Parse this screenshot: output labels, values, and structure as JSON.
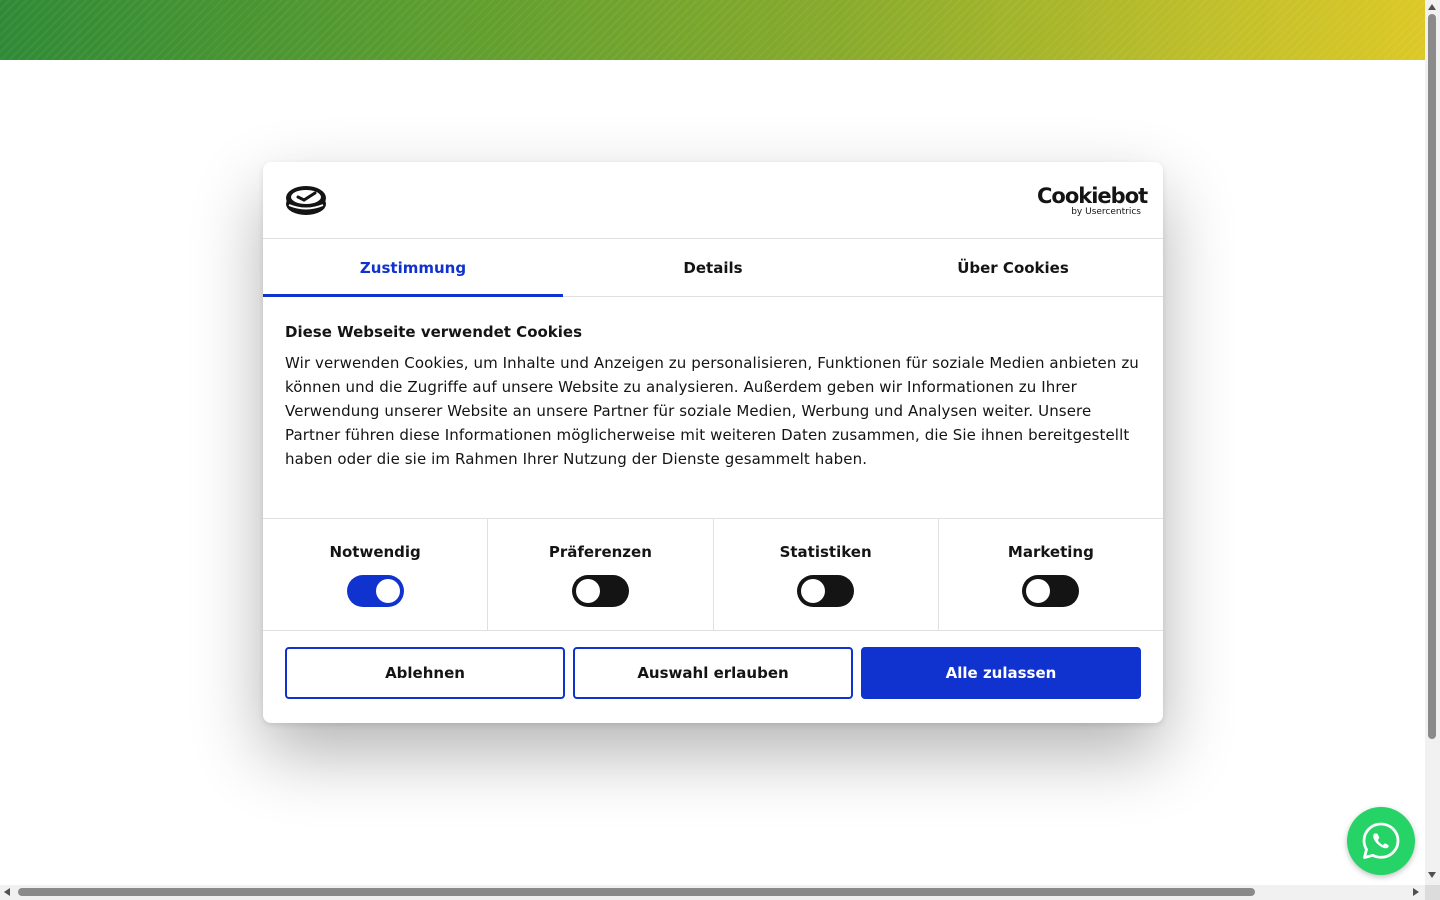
{
  "cookie_dialog": {
    "brand": {
      "name": "Cookiebot",
      "sub": "by Usercentrics"
    },
    "tabs": [
      {
        "label": "Zustimmung",
        "active": true
      },
      {
        "label": "Details",
        "active": false
      },
      {
        "label": "Über Cookies",
        "active": false
      }
    ],
    "title": "Diese Webseite verwendet Cookies",
    "text": "Wir verwenden Cookies, um Inhalte und Anzeigen zu personalisieren, Funktionen für soziale Medien anbieten zu können und die Zugriffe auf unsere Website zu analysieren. Außerdem geben wir Informationen zu Ihrer Verwendung unserer Website an unsere Partner für soziale Medien, Werbung und Analysen weiter. Unsere Partner führen diese Informationen möglicherweise mit weiteren Daten zusammen, die Sie ihnen bereitgestellt haben oder die sie im Rahmen Ihrer Nutzung der Dienste gesammelt haben.",
    "toggles": [
      {
        "label": "Notwendig",
        "on": true
      },
      {
        "label": "Präferenzen",
        "on": false
      },
      {
        "label": "Statistiken",
        "on": false
      },
      {
        "label": "Marketing",
        "on": false
      }
    ],
    "buttons": {
      "reject": "Ablehnen",
      "allow_selection": "Auswahl erlauben",
      "allow_all": "Alle zulassen"
    }
  },
  "colors": {
    "accent": "#1032cf",
    "toggle_off": "#141414",
    "whatsapp": "#25d366",
    "banner_start": "#2f8a36",
    "banner_end": "#dcc826"
  },
  "icons": {
    "brand_logo": "brand-logo-icon",
    "whatsapp": "whatsapp-icon"
  }
}
